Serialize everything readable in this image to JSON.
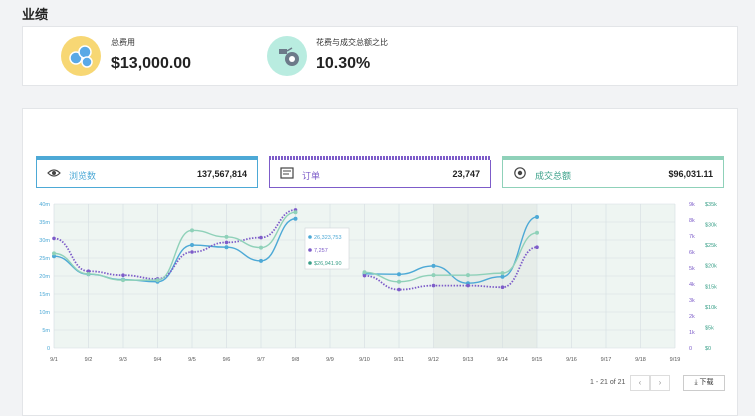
{
  "page": {
    "title": "业绩"
  },
  "kpis": [
    {
      "label": "总费用",
      "value": "$13,000.00",
      "icon": "coins-icon",
      "icon_bg": "#f7d774"
    },
    {
      "label": "花费与成交总额之比",
      "value": "10.30%",
      "icon": "money-bag-icon",
      "icon_bg": "#b9ece0"
    }
  ],
  "metrics": [
    {
      "label": "浏览数",
      "value": "137,567,814",
      "icon": "eye-icon",
      "color": "#4da9d6"
    },
    {
      "label": "订单",
      "value": "23,747",
      "icon": "order-icon",
      "color": "#7d5cc9"
    },
    {
      "label": "成交总额",
      "value": "$96,031.11",
      "icon": "coin-icon",
      "color": "#8fd1b9"
    }
  ],
  "tooltip": {
    "views": "26,323,753",
    "orders": "7,257",
    "gmv": "$26,941.90"
  },
  "pagination": {
    "text": "1 - 21 of 21"
  },
  "download": {
    "label": "下载"
  },
  "chart_data": {
    "type": "line",
    "x": [
      "9/1",
      "9/2",
      "9/3",
      "9/4",
      "9/5",
      "9/6",
      "9/7",
      "9/8",
      "9/9",
      "9/10",
      "9/11",
      "9/12",
      "9/13",
      "9/14",
      "9/15",
      "9/16",
      "9/17",
      "9/18",
      "9/19"
    ],
    "y_left_ticks": [
      "0",
      "5m",
      "10m",
      "15m",
      "20m",
      "25m",
      "30m",
      "35m",
      "40m"
    ],
    "y_right_ticks": [
      "0",
      "1k",
      "2k",
      "3k",
      "4k",
      "5k",
      "6k",
      "7k",
      "8k",
      "9k"
    ],
    "y_right2_ticks": [
      "$0",
      "$5k",
      "$10k",
      "$15k",
      "$20k",
      "$25k",
      "$30k",
      "$35k"
    ],
    "ylim_left": [
      0,
      40000000
    ],
    "series": [
      {
        "name": "浏览数",
        "axis": "left",
        "color": "#4da9d6",
        "style": "solid",
        "values": [
          25500000,
          20500000,
          19000000,
          18400000,
          28600000,
          28000000,
          24200000,
          35900000,
          null,
          20600000,
          20500000,
          22800000,
          18000000,
          19800000,
          36400000,
          null,
          null,
          null,
          null
        ]
      },
      {
        "name": "订单",
        "axis": "right",
        "color": "#7d5cc9",
        "style": "dotted",
        "values": [
          6850,
          4800,
          4550,
          4320,
          6000,
          6600,
          6900,
          8630,
          null,
          4520,
          3650,
          3900,
          3900,
          3800,
          6300,
          null,
          null,
          null,
          null
        ]
      },
      {
        "name": "成交总额",
        "axis": "right2",
        "color": "#8fd1b9",
        "style": "solid",
        "values": [
          23000,
          18000,
          16500,
          16500,
          28600,
          27000,
          24400,
          33000,
          null,
          18400,
          16100,
          17700,
          17700,
          18200,
          28000,
          null,
          null,
          null,
          null
        ]
      }
    ]
  }
}
